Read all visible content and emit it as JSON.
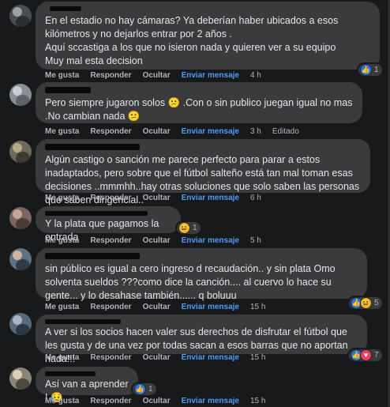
{
  "actions": {
    "like": "Me gusta",
    "reply": "Responder",
    "hide": "Ocultar",
    "send": "Enviar mensaje",
    "edited": "Editado"
  },
  "comments": [
    {
      "text": "En el estadio no hay cámaras? Ya deberían haber ubicados a esos kilómetros y no dejarlos entrar por 2 años .\nAquí sccastiga a los que no isieron nada y quieren ver a su equipo\nMuy mal esta decision",
      "time": "4 h",
      "reactions": [
        "like-icon"
      ],
      "reaction_count": "1"
    },
    {
      "text": "Pero siempre jugaron solos 😕 .Con o sin publico juegan igual no mas .No cambian nada 😕",
      "time": "3 h",
      "edited": true
    },
    {
      "text": "Algún castigo o sanción me parece perfecto para parar a estos inadaptados, pero sobre que el fútbol salteño está tan mal toman esas decisiones ..mmmhh..hay otras soluciones que solo saben las personas que saben dirigencial..",
      "time": "6 h"
    },
    {
      "text": "Y la plata que pagamos la entrada",
      "time": "5 h",
      "reactions": [
        "haha-icon"
      ],
      "reaction_count": "1"
    },
    {
      "text": "sin público es igual a cero ingreso d recaudación.. y sin plata Omo solventa sueldos ???como dice la canción.... al cuervo lo hace su gente... y lo desahase también...... q boluuu",
      "time": "15 h",
      "reactions": [
        "like-icon",
        "haha-icon"
      ],
      "reaction_count": "5"
    },
    {
      "text": "A ver si los socios hacen valer sus derechos de disfrutar el fútbol que les gusta y de una vez por todas sacan a esos barras que no aportan nada!!!",
      "time": "15 h",
      "reactions": [
        "like-icon",
        "love-icon"
      ],
      "reaction_count": "7"
    },
    {
      "text": "Así van a aprender ! 😥",
      "time": "15 h",
      "reactions": [
        "like-icon"
      ],
      "reaction_count": "1"
    }
  ]
}
